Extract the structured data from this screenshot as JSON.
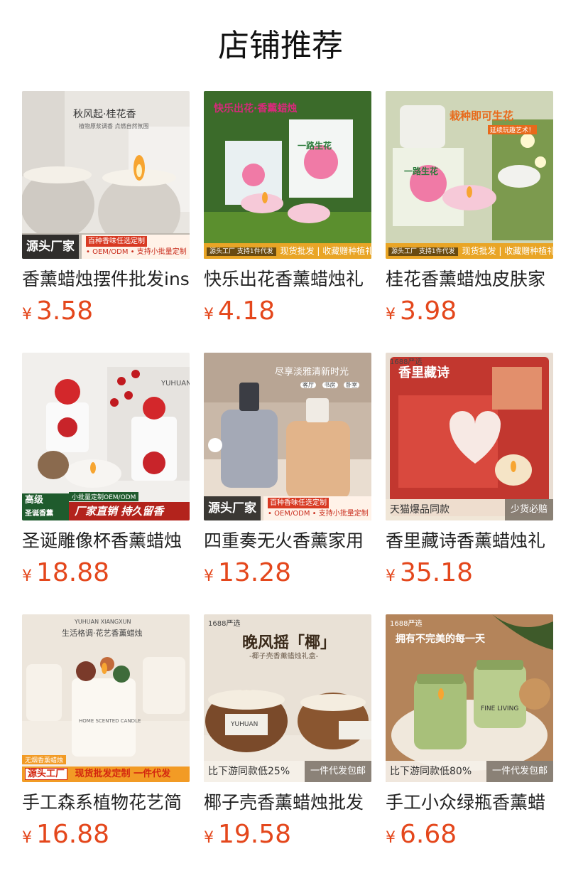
{
  "section_title": "店铺推荐",
  "currency": "¥",
  "products": [
    {
      "name": "香薰蜡烛摆件批发ins",
      "price": "3.58",
      "img_text": {
        "top": "秋风起·桂花香",
        "sub": "植物原浆调香 点燃自然氛围",
        "badge_src": "源头厂家",
        "bar1": "百种香味任选定制",
        "bar2": "• OEM/ODM • 支持小批量定制"
      }
    },
    {
      "name": "快乐出花香薰蜡烛礼",
      "price": "4.18",
      "img_text": {
        "top": "快乐出花·香薰蜡烛",
        "box": "一路生花",
        "badge_small": "源头工厂 支持1件代发",
        "badge_main": "现货批发 | 收藏赠种植礼包"
      }
    },
    {
      "name": "桂花香薰蜡烛皮肤家",
      "price": "3.98",
      "img_text": {
        "top": "栽种即可生花",
        "sub": "延续玩趣艺术！",
        "box": "一路生花",
        "badge_small": "源头工厂 支持1件代发",
        "badge_main": "现货批发 | 收藏赠种植礼包"
      }
    },
    {
      "name": "圣诞雕像杯香薰蜡烛",
      "price": "18.88",
      "img_text": {
        "brand": "YUHUAN",
        "corner1": "高级",
        "corner2": "圣诞香薰",
        "tag": "小批量定制OEM/ODM",
        "badge_main": "厂家直销 持久留香"
      }
    },
    {
      "name": "四重奏无火香薰家用",
      "price": "13.28",
      "img_text": {
        "top": "尽享淡雅清新时光",
        "chips": [
          "客厅",
          "书房",
          "卧室"
        ],
        "badge_src": "源头厂家",
        "bar1": "百种香味任选定制",
        "bar2": "• OEM/ODM • 支持小批量定制"
      }
    },
    {
      "name": "香里藏诗香薰蜡烛礼",
      "price": "35.18",
      "img_text": {
        "tag": "1688严选",
        "top": "香里藏诗",
        "left": "天猫爆品同款",
        "right": "少货必赔"
      }
    },
    {
      "name": "手工森系植物花艺简",
      "price": "16.88",
      "img_text": {
        "brand": "YUHUAN XIANGXUN",
        "top": "生活格调·花艺香薰蜡烛",
        "label": "HOME SCENTED CANDLE",
        "small": "无烟香薰蜡烛",
        "box": "源头工厂",
        "badge_main": "现货批发定制 一件代发"
      }
    },
    {
      "name": "椰子壳香薰蜡烛批发",
      "price": "19.58",
      "img_text": {
        "tag": "1688严选",
        "top": "晚风摇「椰」",
        "sub": "-椰子壳香薰蜡烛礼盒-",
        "label": "YUHUAN",
        "left": "比下游同款低25%",
        "right": "一件代发包邮"
      }
    },
    {
      "name": "手工小众绿瓶香薰蜡",
      "price": "6.68",
      "img_text": {
        "tag": "1688严选",
        "top": "拥有不完美的每一天",
        "label": "FINE LIVING",
        "left": "比下游同款低80%",
        "right": "一件代发包邮"
      }
    }
  ],
  "colors": {
    "price": "#e4471c",
    "title": "#111111"
  }
}
